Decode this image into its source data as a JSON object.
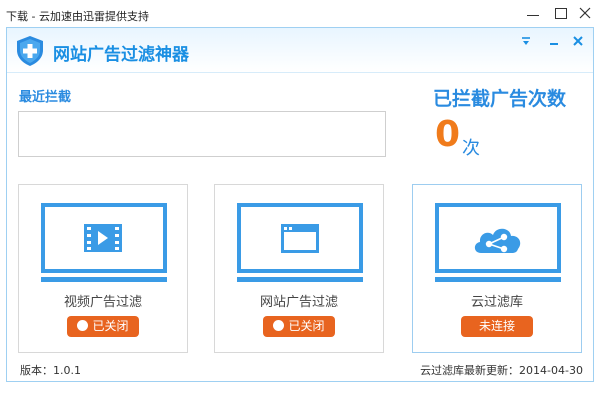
{
  "window": {
    "title": "下载 - 云加速由迅雷提供支持"
  },
  "app": {
    "title": "网站广告过滤神器",
    "header_buttons": [
      "menu-icon",
      "minimize-icon",
      "close-icon"
    ]
  },
  "recent": {
    "label": "最近拦截",
    "content": ""
  },
  "counter": {
    "title": "已拦截广告次数",
    "value": "0",
    "unit": "次"
  },
  "cards": [
    {
      "label": "视频广告过滤",
      "status": "已关闭",
      "icon": "video-icon",
      "has_dot": true
    },
    {
      "label": "网站广告过滤",
      "status": "已关闭",
      "icon": "browser-window-icon",
      "has_dot": true
    },
    {
      "label": "云过滤库",
      "status": "未连接",
      "icon": "cloud-share-icon",
      "has_dot": false
    }
  ],
  "footer": {
    "version": "版本：1.0.1",
    "update": "云过滤库最新更新：2014-04-30"
  },
  "colors": {
    "accent": "#2a8be0",
    "monitor": "#3a9be6",
    "counter": "#f07b1b",
    "toggle": "#e8641f"
  }
}
